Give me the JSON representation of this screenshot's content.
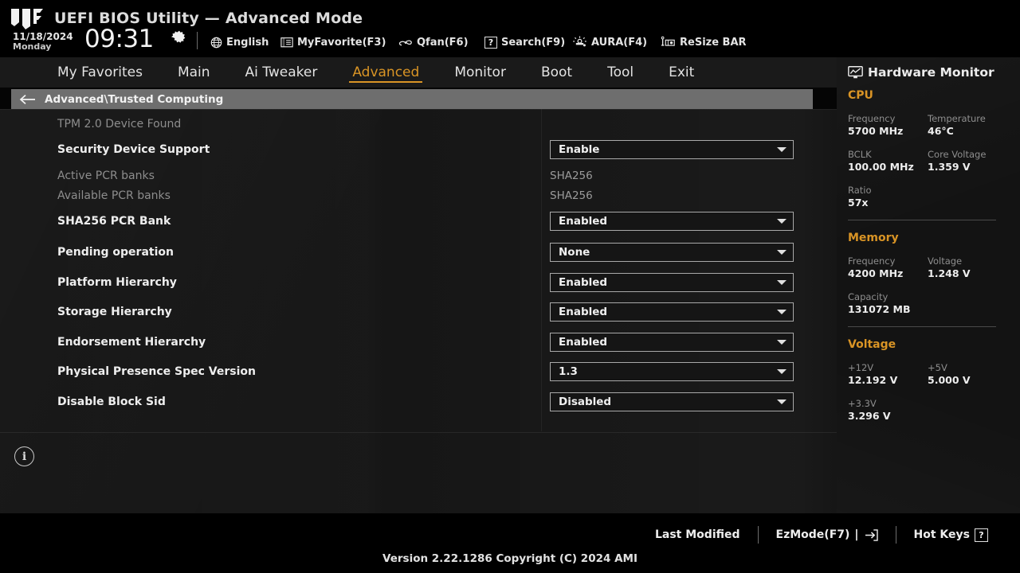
{
  "header": {
    "logo": "tuf-logo",
    "title": "UEFI BIOS Utility — Advanced Mode",
    "date": "11/18/2024",
    "day": "Monday",
    "time": "09:31",
    "gear_icon": "gear-icon",
    "items": [
      {
        "icon": "globe-icon",
        "label": "English"
      },
      {
        "icon": "list-icon",
        "label": "MyFavorite(F3)"
      },
      {
        "icon": "fan-icon",
        "label": "Qfan(F6)"
      },
      {
        "icon": "question-box-icon",
        "label": "Search(F9)"
      },
      {
        "icon": "aura-light-icon",
        "label": "AURA(F4)"
      },
      {
        "icon": "resize-bar-icon",
        "label": "ReSize BAR"
      }
    ]
  },
  "nav": {
    "tabs": [
      {
        "label": "My Favorites",
        "active": false
      },
      {
        "label": "Main",
        "active": false
      },
      {
        "label": "Ai Tweaker",
        "active": false
      },
      {
        "label": "Advanced",
        "active": true
      },
      {
        "label": "Monitor",
        "active": false
      },
      {
        "label": "Boot",
        "active": false
      },
      {
        "label": "Tool",
        "active": false
      },
      {
        "label": "Exit",
        "active": false
      }
    ]
  },
  "breadcrumb": {
    "back_icon": "back-arrow-icon",
    "path": "Advanced\\Trusted Computing"
  },
  "settings": {
    "info_icon": "info-icon",
    "rows": [
      {
        "label": "TPM 2.0 Device Found",
        "type": "static",
        "state": "dim",
        "value": ""
      },
      {
        "label": "Security Device Support",
        "type": "dropdown",
        "state": "on",
        "value": "Enable"
      },
      {
        "label": "Active PCR banks",
        "type": "text",
        "state": "dim",
        "value": "SHA256"
      },
      {
        "label": "Available PCR banks",
        "type": "text",
        "state": "dim",
        "value": "SHA256"
      },
      {
        "label": "SHA256 PCR Bank",
        "type": "dropdown",
        "state": "on",
        "value": "Enabled"
      },
      {
        "label": "Pending operation",
        "type": "dropdown",
        "state": "on",
        "value": "None"
      },
      {
        "label": "Platform Hierarchy",
        "type": "dropdown",
        "state": "on",
        "value": "Enabled"
      },
      {
        "label": "Storage Hierarchy",
        "type": "dropdown",
        "state": "on",
        "value": "Enabled"
      },
      {
        "label": "Endorsement Hierarchy",
        "type": "dropdown",
        "state": "on",
        "value": "Enabled"
      },
      {
        "label": "Physical Presence Spec Version",
        "type": "dropdown",
        "state": "on",
        "value": "1.3"
      },
      {
        "label": "Disable Block Sid",
        "type": "dropdown",
        "state": "on",
        "value": "Disabled"
      }
    ]
  },
  "hardware_monitor": {
    "icon": "monitor-icon",
    "title": "Hardware Monitor",
    "sections": [
      {
        "name": "CPU",
        "rows": [
          [
            {
              "key": "Frequency",
              "value": "5700 MHz"
            },
            {
              "key": "Temperature",
              "value": "46°C"
            }
          ],
          [
            {
              "key": "BCLK",
              "value": "100.00 MHz"
            },
            {
              "key": "Core Voltage",
              "value": "1.359 V"
            }
          ],
          [
            {
              "key": "Ratio",
              "value": "57x"
            }
          ]
        ]
      },
      {
        "name": "Memory",
        "rows": [
          [
            {
              "key": "Frequency",
              "value": "4200 MHz"
            },
            {
              "key": "Voltage",
              "value": "1.248 V"
            }
          ],
          [
            {
              "key": "Capacity",
              "value": "131072 MB"
            }
          ]
        ]
      },
      {
        "name": "Voltage",
        "rows": [
          [
            {
              "key": "+12V",
              "value": "12.192 V"
            },
            {
              "key": "+5V",
              "value": "5.000 V"
            }
          ],
          [
            {
              "key": "+3.3V",
              "value": "3.296 V"
            }
          ]
        ]
      }
    ]
  },
  "footer": {
    "last_modified": "Last Modified",
    "ezmode": "EzMode(F7)",
    "ezmode_icon": "exit-arrow-icon",
    "hotkeys": "Hot Keys",
    "hotkeys_key": "?",
    "version": "Version 2.22.1286 Copyright (C) 2024 AMI"
  },
  "colors": {
    "accent": "#d99425",
    "panel": "#161616",
    "sidebar": "#131313",
    "breadcrumb_bg": "#6e6e6e"
  }
}
